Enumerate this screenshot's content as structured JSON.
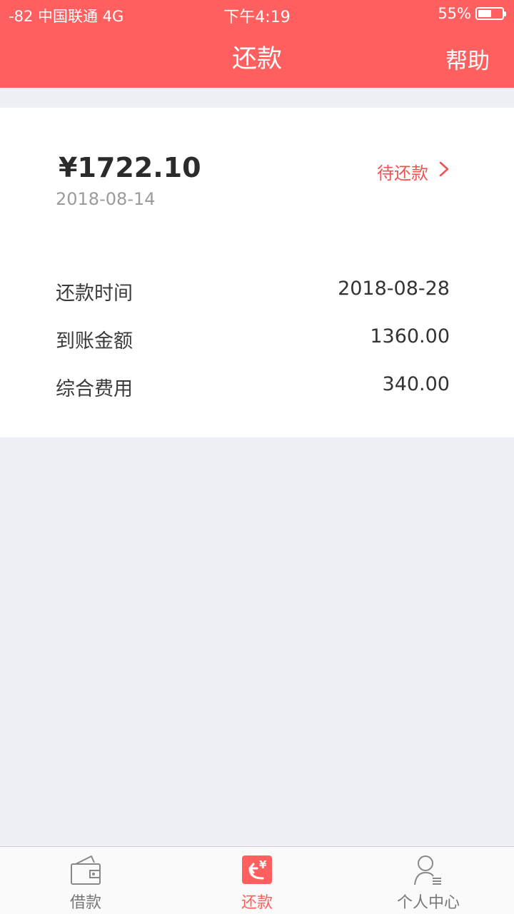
{
  "status_bar": {
    "carrier": "-82 中国联通  4G",
    "time": "下午4:19",
    "battery_percent": "55%",
    "battery_level": 0.55
  },
  "header": {
    "title": "还款",
    "help_label": "帮助"
  },
  "loan": {
    "amount": "¥1722.10",
    "date": "2018-08-14",
    "status_label": "待还款",
    "details": [
      {
        "label": "还款时间",
        "value": "2018-08-28"
      },
      {
        "label": "到账金额",
        "value": "1360.00"
      },
      {
        "label": "综合费用",
        "value": "340.00"
      }
    ]
  },
  "tabs": [
    {
      "label": "借款",
      "icon": "wallet-icon",
      "active": false
    },
    {
      "label": "还款",
      "icon": "repay-icon",
      "active": true
    },
    {
      "label": "个人中心",
      "icon": "profile-icon",
      "active": false
    }
  ],
  "colors": {
    "brand": "#ff5f5f",
    "status_text": "#ef5454",
    "background": "#edf1f5"
  }
}
